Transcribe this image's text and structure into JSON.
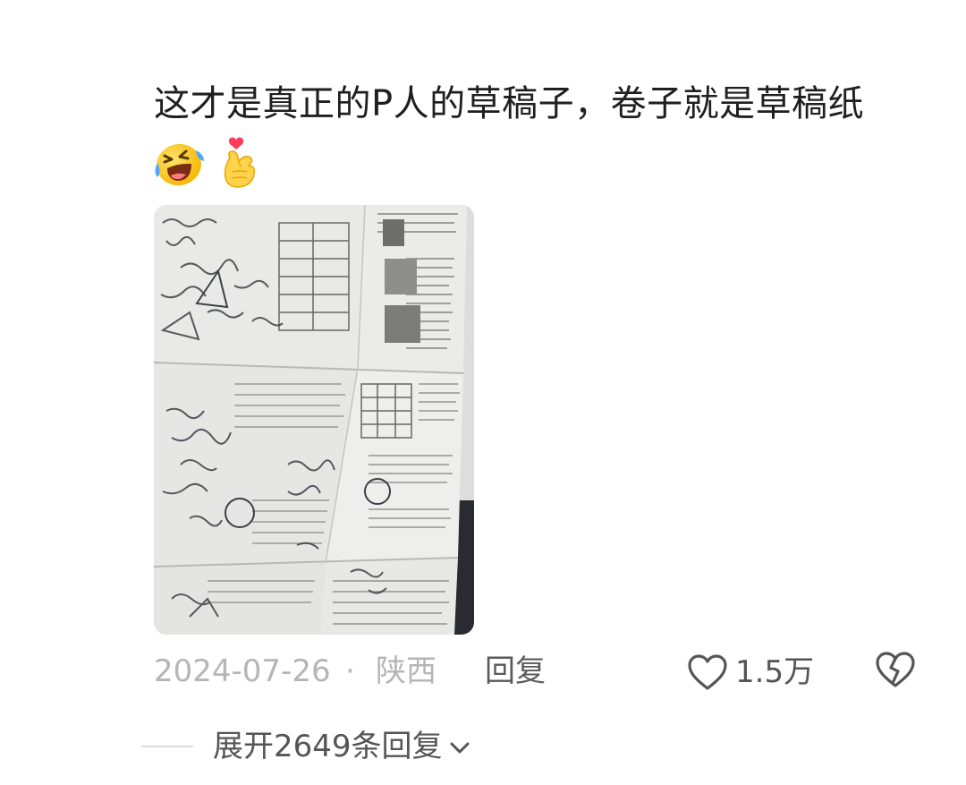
{
  "comment": {
    "text": "这才是真正的P人的草稿子，卷子就是草稿纸",
    "emojis": [
      "laughing-crying-emoji",
      "finger-heart-emoji"
    ]
  },
  "image": {
    "description_icon": "photo-of-exam-papers"
  },
  "meta": {
    "date": "2024-07-26",
    "separator": "·",
    "location": "陕西",
    "reply_label": "回复",
    "like_count": "1.5万"
  },
  "expand": {
    "label": "展开2649条回复"
  },
  "colors": {
    "meta_gray": "#b5b5b5",
    "action_gray": "#555555",
    "background": "#ffffff"
  }
}
